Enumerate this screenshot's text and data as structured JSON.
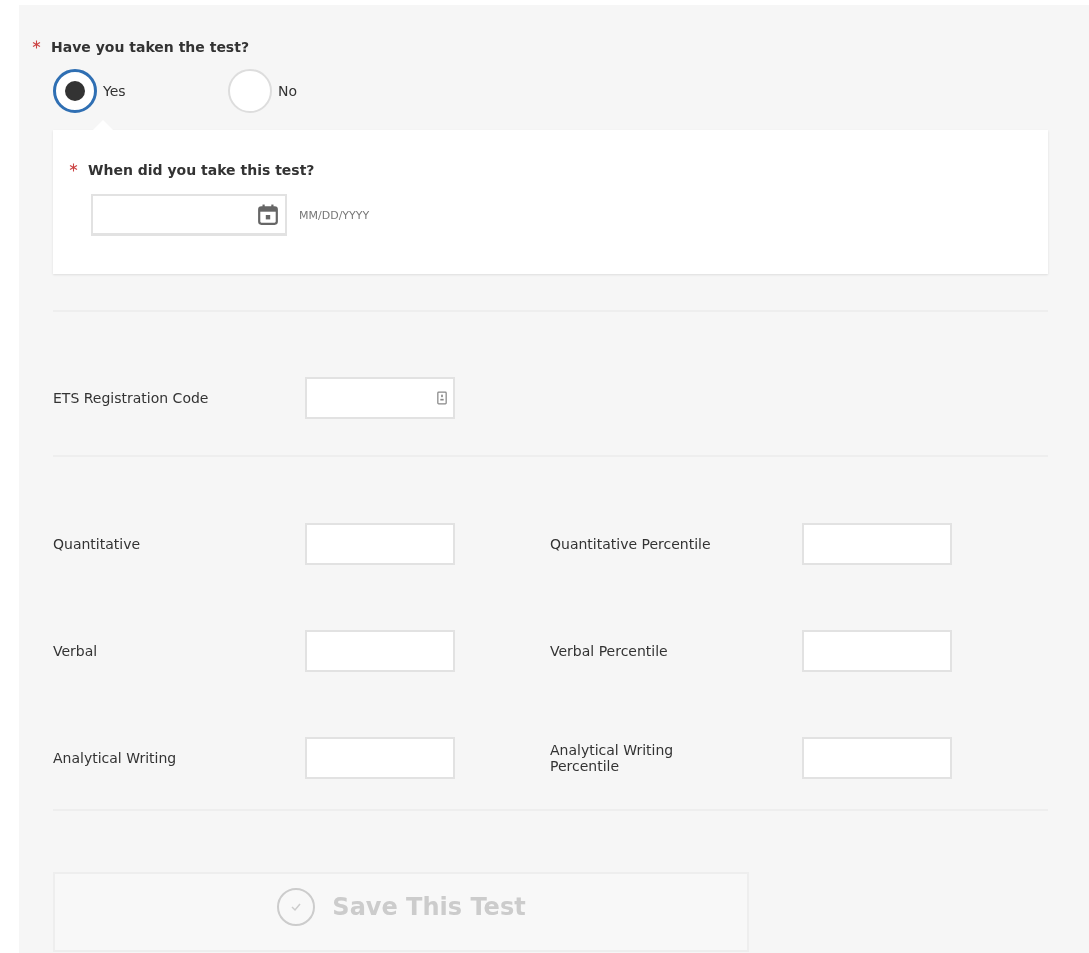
{
  "question": {
    "label": "Have you taken the test?",
    "required": true,
    "options": [
      {
        "label": "Yes",
        "selected": true
      },
      {
        "label": "No",
        "selected": false
      }
    ]
  },
  "date_panel": {
    "label": "When did you take this test?",
    "required": true,
    "format_hint": "MM/DD/YYYY"
  },
  "registration": {
    "label": "ETS Registration Code"
  },
  "scores": [
    {
      "label": "Quantitative",
      "percentile_label": "Quantitative Percentile"
    },
    {
      "label": "Verbal",
      "percentile_label": "Verbal Percentile"
    },
    {
      "label": "Analytical Writing",
      "percentile_label": "Analytical Writing Percentile"
    }
  ],
  "save_button": {
    "label": "Save This Test",
    "disabled": true
  }
}
